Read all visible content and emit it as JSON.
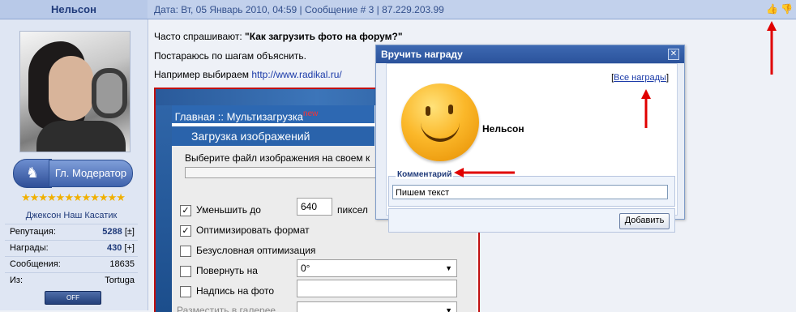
{
  "user": {
    "name": "Нельсон",
    "rank": "Гл. Модератор",
    "stars": "★★★★★★★★★★★★",
    "title": "Джексон Наш Касатик",
    "stats": [
      {
        "label": "Репутация:",
        "value": "5288",
        "extra": "[±]"
      },
      {
        "label": "Награды:",
        "value": "430",
        "extra": "[+]"
      },
      {
        "label": "Сообщения:",
        "value": "18635",
        "extra": ""
      },
      {
        "label": "Из:",
        "value": "Tortuga",
        "extra": ""
      }
    ],
    "status_button": "OFF"
  },
  "post": {
    "meta": "Дата: Вт, 05 Январь 2010, 04:59 | Сообщение # 3 | 87.229.203.99",
    "line1_prefix": "Часто спрашивают: ",
    "line1_bold": "\"Как загрузить фото на форум?\"",
    "line2": "Постараюсь по шагам объяснить.",
    "line3_prefix": "Например выбираем ",
    "line3_link": "http://www.radikal.ru/",
    "thumb_up_icon": "thumb-up-icon",
    "thumb_down_icon": "thumb-down-icon"
  },
  "embed": {
    "nav_main": "Главная",
    "nav_sep": "::",
    "nav_multi": "Мультизагрузка",
    "nav_new": "new",
    "title": "Загрузка изображений",
    "choose_file": "Выберите файл изображения на своем к",
    "reduce_label": "Уменьшить до",
    "reduce_value": "640",
    "reduce_unit": "пиксел",
    "optimize_label": "Оптимизировать формат",
    "uncond_label": "Безусловная оптимизация",
    "rotate_label": "Повернуть на",
    "rotate_value": "0°",
    "caption_label": "Надпись на фото",
    "gallery_label": "Разместить в галерее"
  },
  "dialog": {
    "title": "Вручить награду",
    "all_awards": "Все награды",
    "recipient": "Нельсон",
    "comment_legend": "Комментарий",
    "comment_value": "Пишем текст",
    "add_button": "Добавить"
  }
}
